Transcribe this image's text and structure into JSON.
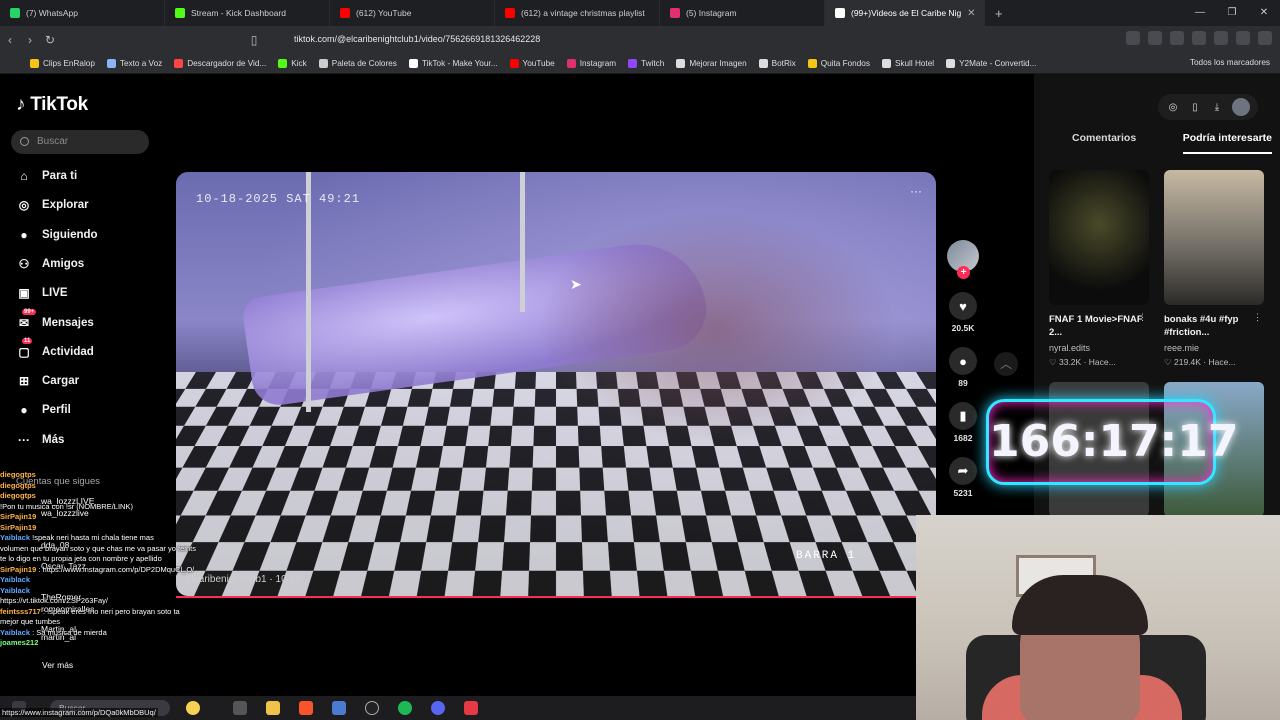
{
  "browser": {
    "tabs": [
      {
        "title": "(7) WhatsApp",
        "color": "#25d366"
      },
      {
        "title": "Stream - Kick Dashboard",
        "color": "#53fc18"
      },
      {
        "title": "(612) YouTube",
        "color": "#ff0000"
      },
      {
        "title": "(612) a vintage christmas playlist",
        "color": "#ff0000"
      },
      {
        "title": "(5) Instagram",
        "color": "#e1306c"
      },
      {
        "title": "(99+)Videos de El Caribe Nig",
        "color": "#ffffff"
      }
    ],
    "url": "tiktok.com/@elcaribenightclub1/video/7562669181326462228",
    "bookmarks": [
      {
        "label": "Clips EnRalop",
        "color": "#f5c518"
      },
      {
        "label": "Texto a Voz",
        "color": "#8ab4f8"
      },
      {
        "label": "Descargador de Vid...",
        "color": "#ff4444"
      },
      {
        "label": "Kick",
        "color": "#53fc18"
      },
      {
        "label": "Paleta de Colores",
        "color": "#cccccc"
      },
      {
        "label": "TikTok - Make Your...",
        "color": "#ffffff"
      },
      {
        "label": "YouTube",
        "color": "#ff0000"
      },
      {
        "label": "Instagram",
        "color": "#e1306c"
      },
      {
        "label": "Twitch",
        "color": "#9146ff"
      },
      {
        "label": "Mejorar Imagen",
        "color": "#dddddd"
      },
      {
        "label": "BotRix",
        "color": "#dddddd"
      },
      {
        "label": "Quita Fondos",
        "color": "#f5c518"
      },
      {
        "label": "Skull Hotel",
        "color": "#dddddd"
      },
      {
        "label": "Y2Mate - Convertid...",
        "color": "#dddddd"
      }
    ],
    "all_bookmarks": "Todos los marcadores"
  },
  "tiktok": {
    "logo": "TikTok",
    "search_placeholder": "Buscar",
    "nav": [
      {
        "label": "Para ti",
        "icon": "home-icon",
        "glyph": "⌂"
      },
      {
        "label": "Explorar",
        "icon": "compass-icon",
        "glyph": "◎"
      },
      {
        "label": "Siguiendo",
        "icon": "following-icon",
        "glyph": "●"
      },
      {
        "label": "Amigos",
        "icon": "friends-icon",
        "glyph": "⚇"
      },
      {
        "label": "LIVE",
        "icon": "live-icon",
        "glyph": "▣"
      },
      {
        "label": "Mensajes",
        "icon": "messages-icon",
        "glyph": "✉",
        "badge": "99+"
      },
      {
        "label": "Actividad",
        "icon": "activity-icon",
        "glyph": "▢",
        "badge": "11"
      },
      {
        "label": "Cargar",
        "icon": "upload-icon",
        "glyph": "⊞"
      },
      {
        "label": "Perfil",
        "icon": "profile-icon",
        "glyph": "●"
      },
      {
        "label": "Más",
        "icon": "more-icon",
        "glyph": "···"
      }
    ],
    "follows_title": "Cuentas que sigues",
    "follows": [
      "wa_lozzzLIVE",
      "wa_lozzzlive",
      "dda_08",
      "Oscar_Tazz",
      "romeomiralles",
      "TheRomer",
      "Martin_al",
      "martin_al"
    ],
    "see_more": "Ver más",
    "video": {
      "timestamp": "10-18-2025 SAT 49:21",
      "watermark": "BARRA 1",
      "author": "elcaribenightclub1",
      "date": "10-18",
      "more": "···"
    },
    "actions": {
      "likes": "20.5K",
      "comments": "89",
      "saves": "1682",
      "shares": "5231"
    },
    "right_panel": {
      "tabs": [
        "Comentarios",
        "Podría interesarte"
      ],
      "active_tab": 1,
      "cards": [
        {
          "caption": "FNAF 1 Movie>FNAF 2...",
          "user": "nyral.edits",
          "views": "33.2K",
          "time": "Hace..."
        },
        {
          "caption": "bonaks #4u #fyp #friction...",
          "user": "reee.mie",
          "views": "219.4K",
          "time": "Hace..."
        }
      ]
    }
  },
  "overlay": {
    "timer": "166:17:17",
    "chat": [
      {
        "user": "diegogtps",
        "msg": "",
        "color": "#ffb347"
      },
      {
        "user": "diegogtps",
        "msg": "",
        "color": "#ffb347"
      },
      {
        "user": "diegogtps",
        "msg": "",
        "color": "#ffb347"
      },
      {
        "user": "",
        "msg": "!Pon tu musica con !sr (NOMBRE/LINK)",
        "color": "#ffffff"
      },
      {
        "user": "SirPajin19",
        "msg": "",
        "color": "#ffb347"
      },
      {
        "user": "SirPajin19",
        "msg": "",
        "color": "#ffb347"
      },
      {
        "user": "Yaiblack",
        "msg": "!speak neri hasta mi chala tiene mas",
        "color": "#5fa8ff"
      },
      {
        "user": "",
        "msg": "volumen que brayan soto y que chas me va pasar yo feints",
        "color": "#ffffff"
      },
      {
        "user": "",
        "msg": "te lo digo en tu propia jeta con nombre y apellido",
        "color": "#ffffff"
      },
      {
        "user": "SirPajin19",
        "msg": ": https://www.instagram.com/p/DP2DMquCl_O/",
        "color": "#ffb347"
      },
      {
        "user": "Yaiblack",
        "msg": "",
        "color": "#5fa8ff"
      },
      {
        "user": "Yaiblack",
        "msg": "",
        "color": "#5fa8ff"
      },
      {
        "user": "",
        "msg": "https://vt.tiktok.com/ZSP263Fay/",
        "color": "#ffffff"
      },
      {
        "user": "feintsss717",
        "msg": ": !speak eres frio neri pero brayan soto ta",
        "color": "#ffb347"
      },
      {
        "user": "",
        "msg": "mejor que tumbes",
        "color": "#ffffff"
      },
      {
        "user": "Yaiblack",
        "msg": ": Sa musica de mierda",
        "color": "#5fa8ff"
      },
      {
        "user": "joames212",
        "msg": "",
        "color": "#7dff7d"
      }
    ],
    "footer_url": "https://www.instagram.com/p/DQa0kMbDBUq/"
  },
  "taskbar": {
    "search": "Buscar"
  }
}
